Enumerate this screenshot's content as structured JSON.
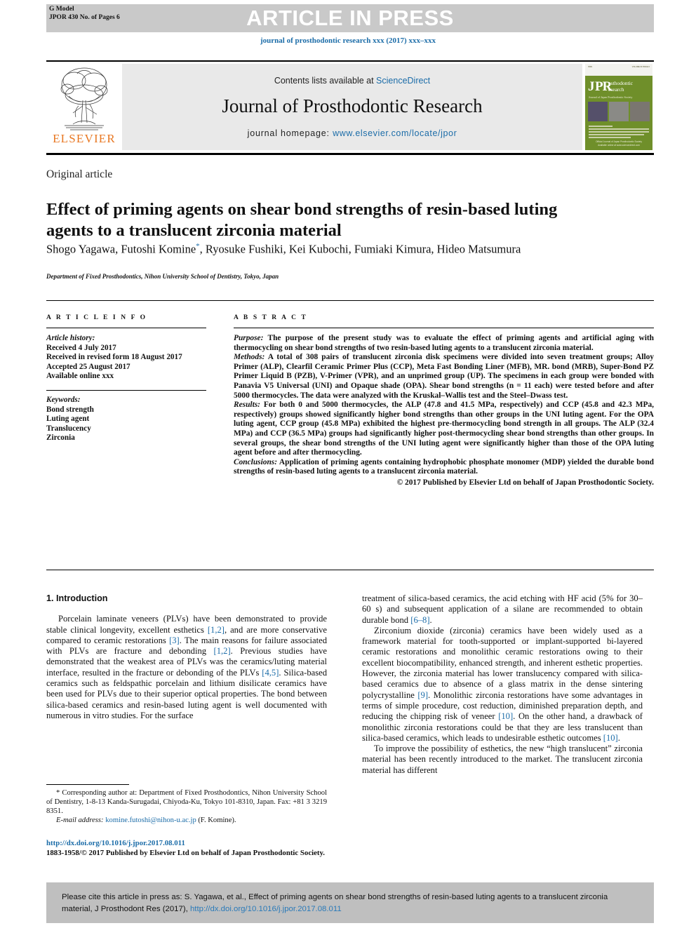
{
  "header": {
    "gmodel_line1": "G Model",
    "gmodel_line2": "JPOR 430 No. of Pages 6",
    "press_banner": "ARTICLE IN PRESS",
    "journal_line": "journal of prosthodontic research xxx (2017) xxx–xxx"
  },
  "masthead": {
    "contents_prefix": "Contents lists available at ",
    "sciencedirect": "ScienceDirect",
    "journal_title": "Journal of Prosthodontic Research",
    "homepage_prefix": "journal homepage: ",
    "homepage_url": "www.elsevier.com/locate/jpor",
    "publisher": "ELSEVIER",
    "cover": {
      "logo_j": "J",
      "logo_pr": "PR",
      "logo_sub1": "osthodontic",
      "logo_sub2": "esearch",
      "logo_tagline": "Journal of Japan Prosthodontic Society",
      "footer1": "Official Journal of Japan Prosthodontic Society",
      "footer2": "Available online at www.sciencedirect.com"
    }
  },
  "article": {
    "type": "Original article",
    "title": "Effect of priming agents on shear bond strengths of resin-based luting agents to a translucent zirconia material",
    "authors": "Shogo Yagawa, Futoshi Komine",
    "authors_rest": ", Ryosuke Fushiki, Kei Kubochi, Fumiaki Kimura, Hideo Matsumura",
    "corresponding_marker": "*",
    "affiliation": "Department of Fixed Prosthodontics, Nihon University School of Dentistry, Tokyo, Japan"
  },
  "article_info": {
    "heading": "A R T I C L E   I N F O",
    "history_label": "Article history:",
    "history": [
      "Received 4 July 2017",
      "Received in revised form 18 August 2017",
      "Accepted 25 August 2017",
      "Available online xxx"
    ],
    "keywords_label": "Keywords:",
    "keywords": [
      "Bond strength",
      "Luting agent",
      "Translucency",
      "Zirconia"
    ]
  },
  "abstract": {
    "heading": "A B S T R A C T",
    "purpose_label": "Purpose:",
    "purpose_text": " The purpose of the present study was to evaluate the effect of priming agents and artificial aging with thermocycling on shear bond strengths of two resin-based luting agents to a translucent zirconia material.",
    "methods_label": "Methods:",
    "methods_text": " A total of 308 pairs of translucent zirconia disk specimens were divided into seven treatment groups; Alloy Primer (ALP), Clearfil Ceramic Primer Plus (CCP), Meta Fast Bonding Liner (MFB), MR. bond (MRB), Super-Bond PZ Primer Liquid B (PZB), V-Primer (VPR), and an unprimed group (UP). The specimens in each group were bonded with Panavia V5 Universal (UNI) and Opaque shade (OPA). Shear bond strengths (n = 11 each) were tested before and after 5000 thermocycles. The data were analyzed with the Kruskal–Wallis test and the Steel–Dwass test.",
    "results_label": "Results:",
    "results_text": " For both 0 and 5000 thermocycles, the ALP (47.8 and 41.5 MPa, respectively) and CCP (45.8 and 42.3 MPa, respectively) groups showed significantly higher bond strengths than other groups in the UNI luting agent. For the OPA luting agent, CCP group (45.8 MPa) exhibited the highest pre-thermocycling bond strength in all groups. The ALP (32.4 MPa) and CCP (36.5 MPa) groups had significantly higher post-thermocycling shear bond strengths than other groups. In several groups, the shear bond strengths of the UNI luting agent were significantly higher than those of the OPA luting agent before and after thermocycling.",
    "conclusions_label": "Conclusions:",
    "conclusions_text": " Application of priming agents containing hydrophobic phosphate monomer (MDP) yielded the durable bond strengths of resin-based luting agents to a translucent zirconia material.",
    "copyright": "© 2017 Published by Elsevier Ltd on behalf of Japan Prosthodontic Society."
  },
  "introduction": {
    "heading": "1. Introduction",
    "left_p1_a": "Porcelain laminate veneers (PLVs) have been demonstrated to provide stable clinical longevity, excellent esthetics ",
    "left_ref1": "[1,2]",
    "left_p1_b": ", and are more conservative compared to ceramic restorations ",
    "left_ref2": "[3]",
    "left_p1_c": ". The main reasons for failure associated with PLVs are fracture and debonding ",
    "left_ref3": "[1,2]",
    "left_p1_d": ". Previous studies have demonstrated that the weakest area of PLVs was the ceramics/luting material interface, resulted in the fracture or debonding of the PLVs ",
    "left_ref4": "[4,5]",
    "left_p1_e": ". Silica-based ceramics such as feldspathic porcelain and lithium disilicate ceramics have been used for PLVs due to their superior optical properties. The bond between silica-based ceramics and resin-based luting agent is well documented with numerous in vitro studies. For the surface",
    "right_p1_a": "treatment of silica-based ceramics, the acid etching with HF acid (5% for 30–60 s) and subsequent application of a silane are recommended to obtain durable bond ",
    "right_ref1": "[6–8]",
    "right_p1_b": ".",
    "right_p2_a": "Zirconium dioxide (zirconia) ceramics have been widely used as a framework material for tooth-supported or implant-supported bi-layered ceramic restorations and monolithic ceramic restorations owing to their excellent biocompatibility, enhanced strength, and inherent esthetic properties. However, the zirconia material has lower translucency compared with silica-based ceramics due to absence of a glass matrix in the dense sintering polycrystalline ",
    "right_ref2": "[9]",
    "right_p2_b": ". Monolithic zirconia restorations have some advantages in terms of simple procedure, cost reduction, diminished preparation depth, and reducing the chipping risk of veneer ",
    "right_ref3": "[10]",
    "right_p2_c": ". On the other hand, a drawback of monolithic zirconia restorations could be that they are less translucent than silica-based ceramics, which leads to undesirable esthetic outcomes ",
    "right_ref4": "[10]",
    "right_p2_d": ".",
    "right_p3": "To improve the possibility of esthetics, the new “high translucent” zirconia material has been recently introduced to the market. The translucent zirconia material has different"
  },
  "footnote": {
    "marker": "*",
    "text": " Corresponding author at: Department of Fixed Prosthodontics, Nihon University School of Dentistry, 1-8-13 Kanda-Surugadai, Chiyoda-Ku, Tokyo 101-8310, Japan. Fax: +81 3 3219 8351.",
    "email_label": "E-mail address:",
    "email": "komine.futoshi@nihon-u.ac.jp",
    "email_suffix": " (F. Komine)."
  },
  "doi_block": {
    "doi_url": "http://dx.doi.org/10.1016/j.jpor.2017.08.011",
    "issn_line": "1883-1958/© 2017 Published by Elsevier Ltd on behalf of Japan Prosthodontic Society."
  },
  "cite_box": {
    "text_a": "Please cite this article in press as: S. Yagawa, et al., Effect of priming agents on shear bond strengths of resin-based luting agents to a translucent zirconia material, J Prosthodont Res (2017), ",
    "link": "http://dx.doi.org/10.1016/j.jpor.2017.08.011"
  }
}
